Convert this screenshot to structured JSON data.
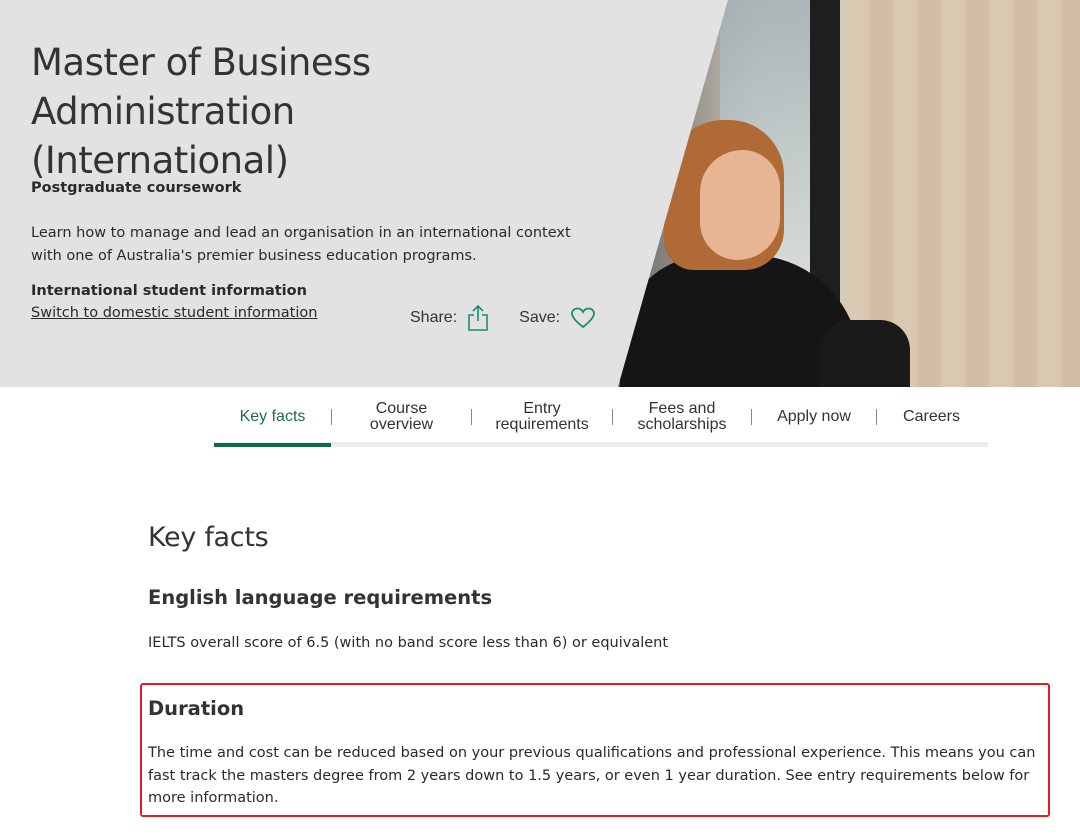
{
  "hero": {
    "title_line1": "Master of Business Administration",
    "title_line2": "(International)",
    "course_type": "Postgraduate coursework",
    "description": "Learn how to manage and lead an organisation in an international context with one of Australia's premier business education programs.",
    "student_info": "International student information",
    "switch_link": "Switch to domestic student information",
    "share_label": "Share:",
    "save_label": "Save:"
  },
  "tabs": [
    {
      "line1": "Key facts",
      "line2": ""
    },
    {
      "line1": "Course",
      "line2": "overview"
    },
    {
      "line1": "Entry",
      "line2": "requirements"
    },
    {
      "line1": "Fees and",
      "line2": "scholarships"
    },
    {
      "line1": "Apply now",
      "line2": ""
    },
    {
      "line1": "Careers",
      "line2": ""
    }
  ],
  "active_tab": "Key facts",
  "content": {
    "title": "Key facts",
    "english": {
      "heading": "English language requirements",
      "text": "IELTS overall score of 6.5 (with no band score less than 6) or equivalent"
    },
    "duration": {
      "heading": "Duration",
      "text": "The time and cost can be reduced based on your previous qualifications and professional experience. This means you can fast track the masters degree from 2 years down to 1.5 years, or even 1 year duration. See entry requirements below for more information."
    }
  },
  "colors": {
    "accent": "#0d6b4f",
    "hero_bg": "#e2e2e2",
    "highlight": "#e02020"
  },
  "icons": {
    "share": "share-upload-icon",
    "save": "heart-icon"
  }
}
